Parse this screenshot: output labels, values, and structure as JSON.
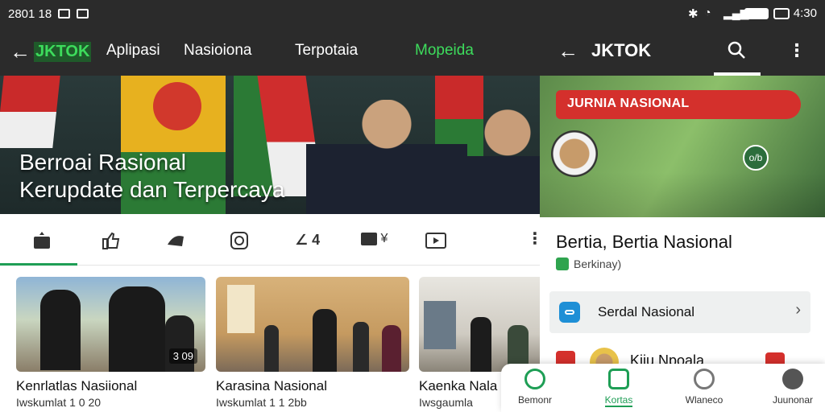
{
  "left_status": {
    "time": "2801 18"
  },
  "left_appbar": {
    "brand": "JKTOK",
    "tabs": [
      "Aplipasi",
      "Nasioiona",
      "Terpotaia",
      "Mopeida"
    ]
  },
  "hero": {
    "line1": "Berroai Rasional",
    "line2": "Kerupdate dan Terpercaya"
  },
  "icon_row": [
    "home-icon",
    "thumbs-up-icon",
    "megaphone-icon",
    "instagram-icon",
    "trend-icon",
    "video-icon",
    "tv-icon"
  ],
  "icon_row_extra": [
    "4",
    "¥"
  ],
  "cards": [
    {
      "title": "Kenrlatlas Nasiional",
      "meta": "Iwskumlat 1 0 20",
      "badge": "3 09"
    },
    {
      "title": "Karasina Nasional",
      "meta": "Iwskumlat 1 1 2bb",
      "badge": ""
    },
    {
      "title": "Kaenka Nala",
      "meta": "Iwsgaumla",
      "badge": ""
    }
  ],
  "right_status": {
    "time": "4:30"
  },
  "right_appbar": {
    "brand": "JKTOK"
  },
  "right_hero": {
    "pill": "JURNIA NASIONAL",
    "badge": "o/b"
  },
  "right_content": {
    "title": "Bertia, Bertia Nasional",
    "subtitle": "Berkinay)",
    "row_label": "Serdal Nasional",
    "next_item": "Kiiu Npoala"
  },
  "bottom_nav": [
    {
      "label": "Bemonr",
      "icon": "home-icon"
    },
    {
      "label": "Kortas",
      "icon": "leaf-icon",
      "active": true
    },
    {
      "label": "Wlaneco",
      "icon": "chat-icon"
    },
    {
      "label": "Juunonar",
      "icon": "profile-icon"
    }
  ],
  "colors": {
    "accent": "#1e9e55",
    "brand_green": "#3ddc5c",
    "alert_red": "#d4302c"
  }
}
